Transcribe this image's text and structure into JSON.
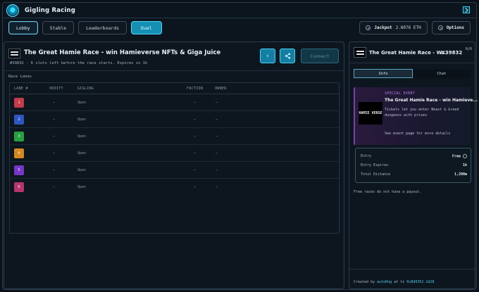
{
  "app": {
    "title": "Gigling Racing"
  },
  "nav": {
    "lobby": "Lobby",
    "stable": "Stable",
    "leaderboards": "Leaderboards",
    "duel": "Duel",
    "jackpot_label": "Jackpot",
    "jackpot_value": "2.8076 ETH",
    "options": "Options"
  },
  "race": {
    "title": "The Great Hamie Race - win Hamieverse NFTs & Giga Juice",
    "subtitle": "#39832 · 6 slots left before the race starts. Expires in 1h",
    "back_icon": "chevron-left-icon",
    "share_icon": "share-icon",
    "connect": "Connect",
    "lanes_label": "Race Lanes"
  },
  "table": {
    "headers": [
      "LANE #",
      "ODDITY",
      "GIGLING",
      "FACTION",
      "OWNER"
    ],
    "rows": [
      {
        "lane": "1",
        "color": "#c33b4a",
        "oddity": "–",
        "gigling": "Open",
        "faction": "–",
        "owner": "–"
      },
      {
        "lane": "2",
        "color": "#2e56c4",
        "oddity": "–",
        "gigling": "Open",
        "faction": "–",
        "owner": "–"
      },
      {
        "lane": "3",
        "color": "#27a040",
        "oddity": "–",
        "gigling": "Open",
        "faction": "–",
        "owner": "–"
      },
      {
        "lane": "4",
        "color": "#d4891e",
        "oddity": "–",
        "gigling": "Open",
        "faction": "–",
        "owner": "–"
      },
      {
        "lane": "5",
        "color": "#7636c8",
        "oddity": "–",
        "gigling": "Open",
        "faction": "–",
        "owner": "–"
      },
      {
        "lane": "6",
        "color": "#b8336e",
        "oddity": "–",
        "gigling": "Open",
        "faction": "–",
        "owner": "–"
      }
    ]
  },
  "side": {
    "title": "The Great Hamie Race - W...",
    "id": "#39832",
    "count": "0/6",
    "tabs": [
      "Info",
      "Chat"
    ],
    "event": {
      "kicker": "SPECIAL EVENT",
      "title": "The Great Hamie Race - win Hamieve...",
      "desc": "Tickets let you enter Beast & Greed dungeons with prizes",
      "more": "See event page for more details",
      "image_text": "HAMIE VERSE"
    },
    "info": [
      {
        "label": "Entry",
        "value": "Free"
      },
      {
        "label": "Entry Expires",
        "value": "1h"
      },
      {
        "label": "Total Distance",
        "value": "1,200m"
      }
    ],
    "payout_note": "Free races do not have a payout.",
    "created_prefix": "Created by",
    "created_by": "autoHog",
    "created_at": "at tx",
    "tx": "0x8d9352.1d28"
  }
}
